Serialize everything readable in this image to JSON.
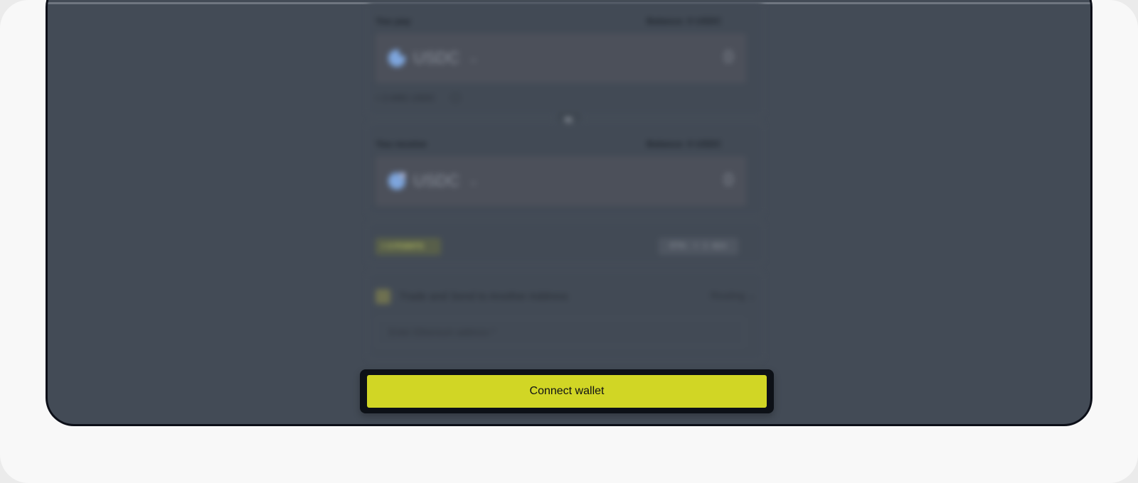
{
  "pay": {
    "label": "You pay",
    "balance": "Balance: 0 USDC",
    "token": "USDC",
    "amount": "0",
    "rate": "≈ 2.4491 USDC"
  },
  "receive": {
    "label": "You receive",
    "balance": "Balance: 0 USDC",
    "token": "USDC",
    "amount": "0"
  },
  "badges": {
    "points": "+ 0 POINTS",
    "eta": "ETA: < 1 min"
  },
  "send_option": {
    "label": "Trade and Send to Another Address",
    "routing": "Routing",
    "address_placeholder": "Enter Ethereum address *"
  },
  "connect_button": "Connect wallet",
  "icons": {
    "token": "usdc-token-icon",
    "swap": "swap-arrows-icon",
    "chevron": "chevron-down-icon",
    "info": "info-icon",
    "checkbox": "checkbox-icon"
  },
  "colors": {
    "accent": "#d1d625",
    "overlay": "#434b56",
    "frame": "#0c0f18"
  }
}
